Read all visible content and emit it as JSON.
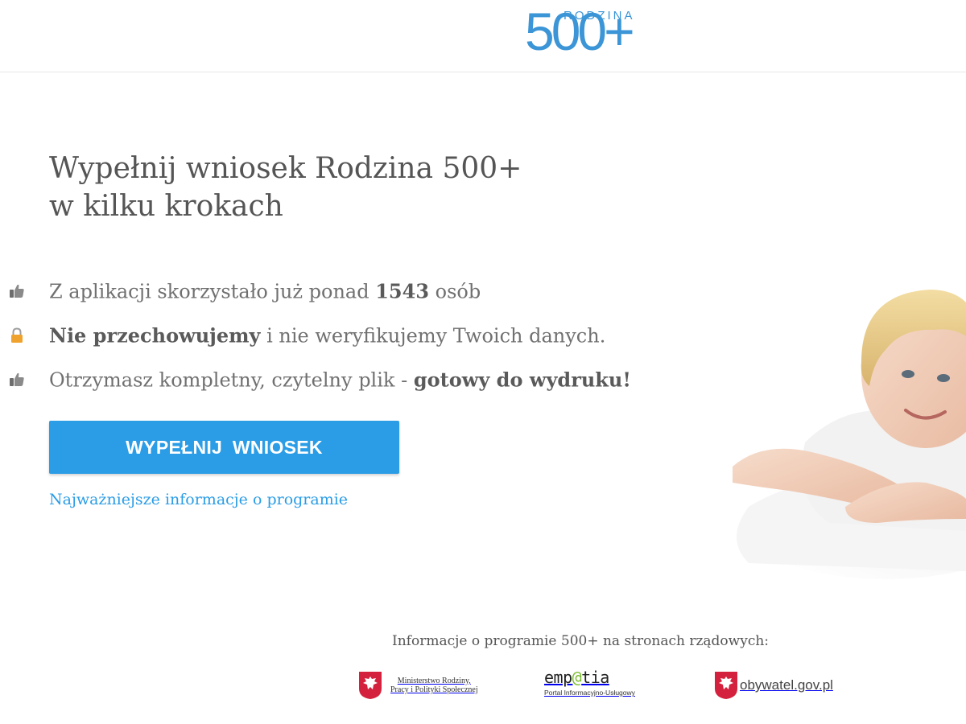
{
  "header": {
    "logo_number": "500+",
    "logo_word": "RODZINA"
  },
  "hero": {
    "headline_line1": "Wypełnij wniosek Rodzina 500+",
    "headline_line2": "w kilku krokach"
  },
  "features": [
    {
      "icon": "thumbs-up-icon",
      "text_before": "Z aplikacji skorzystało już ponad ",
      "bold": "1543",
      "text_after": " osób"
    },
    {
      "icon": "lock-icon",
      "bold": "Nie przechowujemy",
      "text_after": " i nie weryfikujemy Twoich danych."
    },
    {
      "icon": "thumbs-up-icon",
      "text_before": "Otrzymasz kompletny, czytelny plik - ",
      "bold": "gotowy do wydruku!"
    }
  ],
  "cta": {
    "label": "WYPEŁNIJ WNIOSEK"
  },
  "info_link": {
    "label": "Najważniejsze informacje o programie"
  },
  "footer": {
    "title": "Informacje o programie 500+ na stronach rządowych:",
    "ministry_line1": "Ministerstwo Rodziny,",
    "ministry_line2": "Pracy i Polityki Społecznej",
    "empatia_pre": "emp",
    "empatia_at": "@",
    "empatia_post": "tia",
    "empatia_sub": "Portal Informacyjno-Usługowy",
    "obywatel": "obywatel.gov.pl"
  },
  "colors": {
    "accent": "#2b9de6",
    "logo": "#3b95d6",
    "text": "#555555",
    "crest_red": "#d4213d",
    "lock": "#f0a22e"
  }
}
